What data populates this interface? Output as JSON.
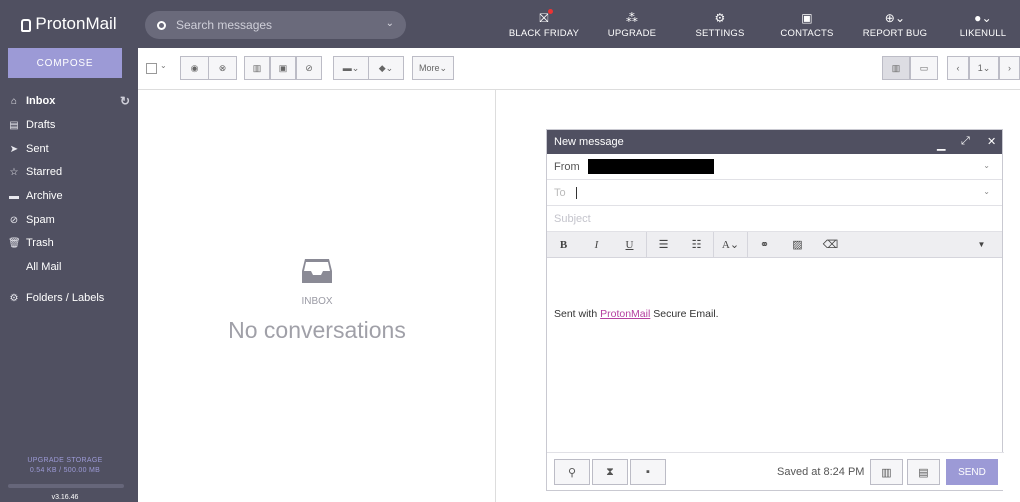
{
  "brand": {
    "name": "ProtonMail"
  },
  "search": {
    "placeholder": "Search messages"
  },
  "topnav": [
    {
      "label": "BLACK FRIDAY",
      "icon": "gift-icon"
    },
    {
      "label": "UPGRADE",
      "icon": "upgrade-icon"
    },
    {
      "label": "SETTINGS",
      "icon": "gear-icon"
    },
    {
      "label": "CONTACTS",
      "icon": "contacts-icon"
    },
    {
      "label": "REPORT BUG",
      "icon": "globe-icon"
    },
    {
      "label": "LIKENULL",
      "icon": "user-icon"
    }
  ],
  "sidebar": {
    "compose_label": "COMPOSE",
    "items": [
      {
        "label": "Inbox",
        "icon": "inbox-icon",
        "active": true
      },
      {
        "label": "Drafts",
        "icon": "drafts-icon"
      },
      {
        "label": "Sent",
        "icon": "sent-icon"
      },
      {
        "label": "Starred",
        "icon": "star-icon"
      },
      {
        "label": "Archive",
        "icon": "archive-icon"
      },
      {
        "label": "Spam",
        "icon": "spam-icon"
      },
      {
        "label": "Trash",
        "icon": "trash-icon"
      },
      {
        "label": "All Mail",
        "icon": ""
      },
      {
        "label": "Folders / Labels",
        "icon": "gear-icon"
      }
    ],
    "upgrade_storage_label": "UPGRADE STORAGE",
    "storage_usage": "0.54 KB / 500.00 MB",
    "version": "v3.16.46"
  },
  "toolbar": {
    "more_label": "More",
    "page_label": "1"
  },
  "empty_state": {
    "label": "INBOX",
    "message": "No conversations"
  },
  "composer": {
    "title": "New message",
    "from_label": "From",
    "to_label": "To",
    "subject_placeholder": "Subject",
    "body_prefix": "Sent with ",
    "body_link": "ProtonMail",
    "body_suffix": " Secure Email.",
    "saved_text": "Saved at 8:24 PM",
    "send_label": "SEND"
  },
  "colors": {
    "topbar": "#505061",
    "accent": "#9c9ad6",
    "link": "#b53fa0"
  }
}
